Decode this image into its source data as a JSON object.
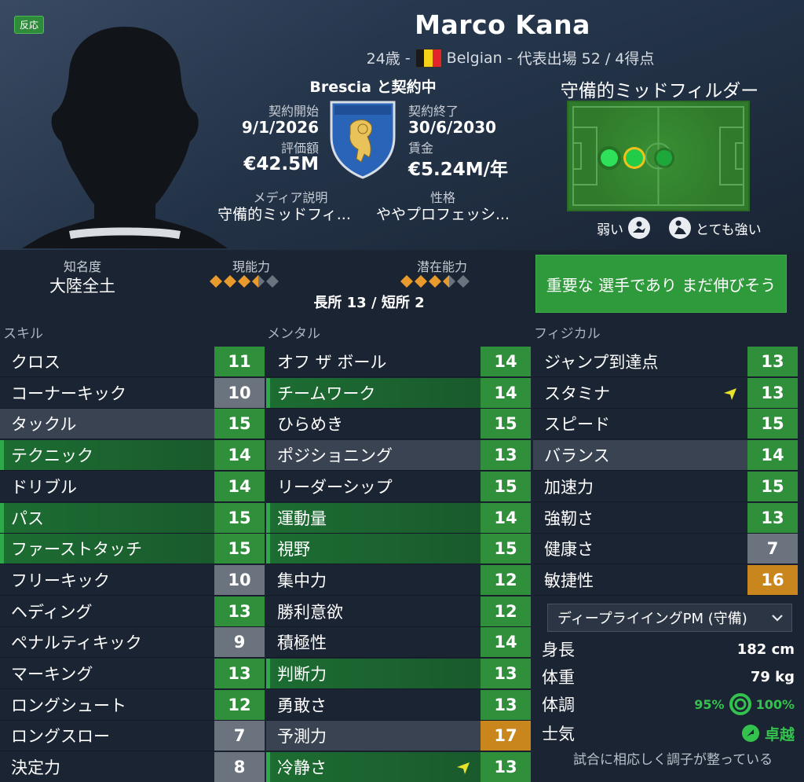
{
  "header": {
    "reaction_label": "反応",
    "player_name": "Marco Kana",
    "age": "24歳",
    "sep1": "-",
    "nationality": "Belgian",
    "sep2": "-",
    "caps": "代表出場 52 / 4得点",
    "flag_colors": [
      "#1a1a1a",
      "#f7d117",
      "#e3242b"
    ]
  },
  "contract": {
    "club_status": "Brescia と契約中",
    "start_label": "契約開始",
    "start_value": "9/1/2026",
    "end_label": "契約終了",
    "end_value": "30/6/2030",
    "valuation_label": "評価額",
    "valuation_value": "€42.5M",
    "wage_label": "賃金",
    "wage_value": "€5.24M/年",
    "media_label": "メディア説明",
    "media_value": "守備的ミッドフィ...",
    "personality_label": "性格",
    "personality_value": "ややプロフェッシ..."
  },
  "position": {
    "title": "守備的ミッドフィルダー",
    "weak_label": "弱い",
    "strong_label": "とても強い"
  },
  "profile": {
    "fame_label": "知名度",
    "fame_value": "大陸全土",
    "current_label": "現能力",
    "current_stars": 3.5,
    "potential_label": "潜在能力",
    "potential_stars": 3.5,
    "strengths": "長所 13 / 短所 2",
    "verdict": "重要な 選手であり まだ伸びそう"
  },
  "sections": {
    "skills_title": "スキル",
    "mental_title": "メンタル",
    "physical_title": "フィジカル"
  },
  "skills": [
    {
      "name": "クロス",
      "value": "11"
    },
    {
      "name": "コーナーキック",
      "value": "10"
    },
    {
      "name": "タックル",
      "value": "15"
    },
    {
      "name": "テクニック",
      "value": "14"
    },
    {
      "name": "ドリブル",
      "value": "14"
    },
    {
      "name": "パス",
      "value": "15"
    },
    {
      "name": "ファーストタッチ",
      "value": "15"
    },
    {
      "name": "フリーキック",
      "value": "10"
    },
    {
      "name": "ヘディング",
      "value": "13"
    },
    {
      "name": "ペナルティキック",
      "value": "9"
    },
    {
      "name": "マーキング",
      "value": "13"
    },
    {
      "name": "ロングシュート",
      "value": "12"
    },
    {
      "name": "ロングスロー",
      "value": "7"
    },
    {
      "name": "決定力",
      "value": "8"
    }
  ],
  "mental": [
    {
      "name": "オフ ザ ボール",
      "value": "14"
    },
    {
      "name": "チームワーク",
      "value": "14"
    },
    {
      "name": "ひらめき",
      "value": "15"
    },
    {
      "name": "ポジショニング",
      "value": "13"
    },
    {
      "name": "リーダーシップ",
      "value": "15"
    },
    {
      "name": "運動量",
      "value": "14"
    },
    {
      "name": "視野",
      "value": "15"
    },
    {
      "name": "集中力",
      "value": "12"
    },
    {
      "name": "勝利意欲",
      "value": "12"
    },
    {
      "name": "積極性",
      "value": "14"
    },
    {
      "name": "判断力",
      "value": "13"
    },
    {
      "name": "勇敢さ",
      "value": "13"
    },
    {
      "name": "予測力",
      "value": "17"
    },
    {
      "name": "冷静さ",
      "value": "13"
    }
  ],
  "physical": [
    {
      "name": "ジャンプ到達点",
      "value": "13"
    },
    {
      "name": "スタミナ",
      "value": "13"
    },
    {
      "name": "スピード",
      "value": "15"
    },
    {
      "name": "バランス",
      "value": "14"
    },
    {
      "name": "加速力",
      "value": "15"
    },
    {
      "name": "強靭さ",
      "value": "13"
    },
    {
      "name": "健康さ",
      "value": "7"
    },
    {
      "name": "敏捷性",
      "value": "16"
    }
  ],
  "role_dropdown": "ディープライイングPM (守備)",
  "info": {
    "height_label": "身長",
    "height_value": "182 cm",
    "weight_label": "体重",
    "weight_value": "79 kg",
    "condition_label": "体調",
    "condition_value": "95%",
    "fitness_value": "100%",
    "morale_label": "士気",
    "morale_value": "卓越",
    "note": "試合に相応しく調子が整っている"
  },
  "colors": {
    "green_cell": "#2f8f3a",
    "gray_cell": "#6b737e",
    "orange_cell": "#c8861c",
    "accent_green": "#2f9a3c"
  }
}
